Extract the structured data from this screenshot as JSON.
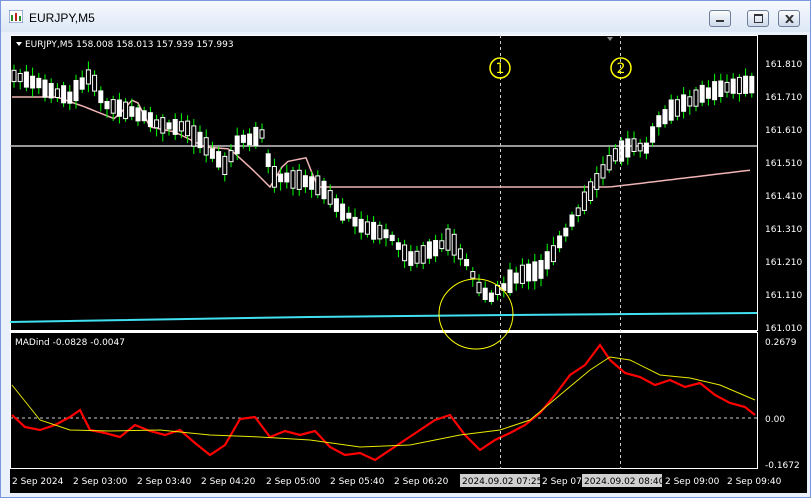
{
  "window": {
    "title": "EURJPY,M5",
    "minimize_icon": "minimize-icon",
    "restore_icon": "restore-icon",
    "close_icon": "close-icon"
  },
  "chart": {
    "header": "EURJPY,M5  158.008 158.013 157.939 157.993",
    "indicator_header": "MADind -0.0828 -0.0047",
    "markers": [
      "1",
      "2"
    ],
    "price_ticks": [
      "161.810",
      "161.710",
      "161.610",
      "161.510",
      "161.410",
      "161.310",
      "161.210",
      "161.110",
      "161.010"
    ],
    "indicator_ticks": [
      "0.2679",
      "0.00",
      "-0.1672"
    ],
    "time_labels": [
      "2 Sep 2024",
      "2 Sep 03:00",
      "2 Sep 03:40",
      "2 Sep 04:20",
      "2 Sep 05:00",
      "2 Sep 05:40",
      "2 Sep 06:20",
      "2024.09.02 07:25",
      "2 Sep 07:40",
      "2024.09.02 08:40",
      "2 Sep 09:00",
      "2 Sep 09:40"
    ],
    "colors": {
      "background": "#000000",
      "bull_candle": "#ffffff",
      "bear_candle": "#ffffff",
      "wick": "#00ff00",
      "ma_pink": "#f0b4b4",
      "ma_cyan": "#40e0f0",
      "level_line": "#c8c8c8",
      "madind_main": "#ff0000",
      "madind_signal": "#e8e800",
      "marker": "#ffff00",
      "axis_text": "#ffffff"
    }
  }
}
